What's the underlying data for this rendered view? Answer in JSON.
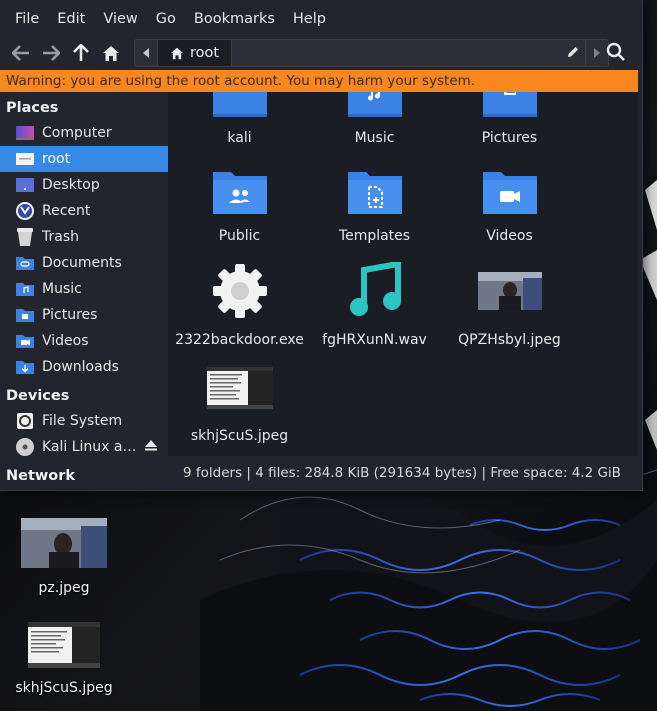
{
  "menubar": [
    "File",
    "Edit",
    "View",
    "Go",
    "Bookmarks",
    "Help"
  ],
  "path": {
    "segment": "root"
  },
  "warning": "Warning: you are using the root account. You may harm your system.",
  "sidebar": {
    "places_header": "Places",
    "places": [
      {
        "label": "Computer",
        "icon": "computer-icon"
      },
      {
        "label": "root",
        "icon": "home-folder-icon",
        "active": true
      },
      {
        "label": "Desktop",
        "icon": "desktop-icon"
      },
      {
        "label": "Recent",
        "icon": "recent-icon"
      },
      {
        "label": "Trash",
        "icon": "trash-icon"
      },
      {
        "label": "Documents",
        "icon": "documents-folder-icon"
      },
      {
        "label": "Music",
        "icon": "music-folder-icon"
      },
      {
        "label": "Pictures",
        "icon": "pictures-folder-icon"
      },
      {
        "label": "Videos",
        "icon": "videos-folder-icon"
      },
      {
        "label": "Downloads",
        "icon": "downloads-folder-icon"
      }
    ],
    "devices_header": "Devices",
    "devices": [
      {
        "label": "File System",
        "icon": "drive-icon"
      },
      {
        "label": "Kali Linux a…",
        "icon": "optical-disc-icon"
      }
    ],
    "network_header": "Network"
  },
  "files": [
    {
      "label": "kali",
      "icon": "folder-icon"
    },
    {
      "label": "Music",
      "icon": "music-folder-icon"
    },
    {
      "label": "Pictures",
      "icon": "pictures-folder-icon"
    },
    {
      "label": "Public",
      "icon": "public-folder-icon"
    },
    {
      "label": "Templates",
      "icon": "templates-folder-icon"
    },
    {
      "label": "Videos",
      "icon": "videos-folder-icon"
    },
    {
      "label": "2322backdoor.exe",
      "icon": "executable-gear-icon"
    },
    {
      "label": "fgHRXunN.wav",
      "icon": "audio-file-icon"
    },
    {
      "label": "QPZHsbyl.jpeg",
      "icon": "image-thumbnail"
    },
    {
      "label": "skhjScuS.jpeg",
      "icon": "image-thumbnail"
    }
  ],
  "status": "9 folders  |  4 files: 284.8 KiB (291634 bytes)  |  Free space: 4.2 GiB",
  "desktop": [
    {
      "label": "pz.jpeg"
    },
    {
      "label": "skhjScuS.jpeg"
    }
  ],
  "colors": {
    "accent": "#368ae6",
    "warning": "#f8871f",
    "folder": "#3c82e6"
  }
}
